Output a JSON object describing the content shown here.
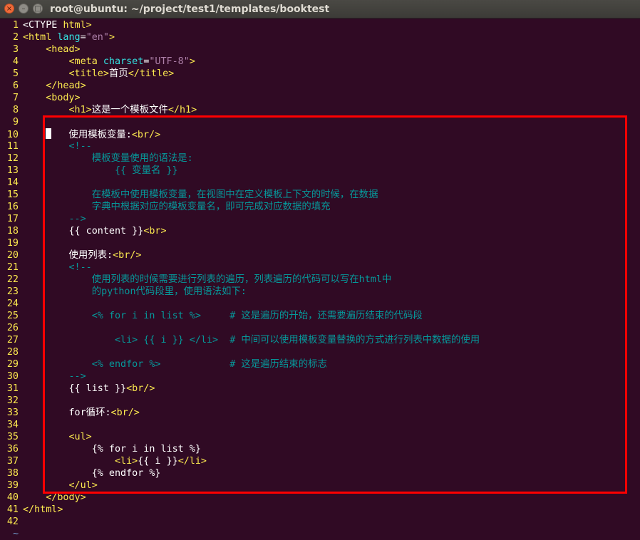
{
  "window": {
    "title": "root@ubuntu: ~/project/test1/templates/booktest",
    "buttons": {
      "close": "×",
      "minimize": "–",
      "maximize": "□"
    }
  },
  "editor": {
    "lines": [
      {
        "n": "1",
        "segs": [
          {
            "c": "txt",
            "t": "<CTYPE "
          },
          {
            "c": "tag",
            "t": "html>"
          }
        ]
      },
      {
        "n": "2",
        "segs": [
          {
            "c": "tag",
            "t": "<html "
          },
          {
            "c": "attr",
            "t": "lang"
          },
          {
            "c": "txt",
            "t": "="
          },
          {
            "c": "str",
            "t": "\"en\""
          },
          {
            "c": "tag",
            "t": ">"
          }
        ]
      },
      {
        "n": "3",
        "segs": [
          {
            "c": "txt",
            "t": "    "
          },
          {
            "c": "tag",
            "t": "<head>"
          }
        ]
      },
      {
        "n": "4",
        "segs": [
          {
            "c": "txt",
            "t": "        "
          },
          {
            "c": "tag",
            "t": "<meta "
          },
          {
            "c": "attr",
            "t": "charset"
          },
          {
            "c": "txt",
            "t": "="
          },
          {
            "c": "str",
            "t": "\"UTF-8\""
          },
          {
            "c": "tag",
            "t": ">"
          }
        ]
      },
      {
        "n": "5",
        "segs": [
          {
            "c": "txt",
            "t": "        "
          },
          {
            "c": "tag",
            "t": "<title>"
          },
          {
            "c": "txt",
            "t": "首页"
          },
          {
            "c": "tag",
            "t": "</title>"
          }
        ]
      },
      {
        "n": "6",
        "segs": [
          {
            "c": "txt",
            "t": "    "
          },
          {
            "c": "tag",
            "t": "</head>"
          }
        ]
      },
      {
        "n": "7",
        "segs": [
          {
            "c": "txt",
            "t": "    "
          },
          {
            "c": "tag",
            "t": "<body>"
          }
        ]
      },
      {
        "n": "8",
        "segs": [
          {
            "c": "txt",
            "t": "        "
          },
          {
            "c": "tag",
            "t": "<h1>"
          },
          {
            "c": "txt",
            "t": "这是一个模板文件"
          },
          {
            "c": "tag",
            "t": "</h1>"
          }
        ]
      },
      {
        "n": "9",
        "segs": []
      },
      {
        "n": "10",
        "segs": [
          {
            "c": "txt",
            "t": "    "
          },
          {
            "c": "cursor",
            "t": ""
          },
          {
            "c": "txt",
            "t": "   使用模板变量:"
          },
          {
            "c": "tag",
            "t": "<br/>"
          }
        ]
      },
      {
        "n": "11",
        "segs": [
          {
            "c": "cm",
            "t": "        <!--"
          }
        ]
      },
      {
        "n": "12",
        "segs": [
          {
            "c": "cm",
            "t": "            模板变量使用的语法是:"
          }
        ]
      },
      {
        "n": "13",
        "segs": [
          {
            "c": "cm",
            "t": "                {{ 变量名 }}"
          }
        ]
      },
      {
        "n": "14",
        "segs": []
      },
      {
        "n": "15",
        "segs": [
          {
            "c": "cm",
            "t": "            在模板中使用模板变量，在视图中在定义模板上下文的时候，在数据"
          }
        ]
      },
      {
        "n": "16",
        "segs": [
          {
            "c": "cm",
            "t": "            字典中根据对应的模板变量名，即可完成对应数据的填充"
          }
        ]
      },
      {
        "n": "17",
        "segs": [
          {
            "c": "cm",
            "t": "        -->"
          }
        ]
      },
      {
        "n": "18",
        "segs": [
          {
            "c": "txt",
            "t": "        {{ content }}"
          },
          {
            "c": "tag",
            "t": "<br>"
          }
        ]
      },
      {
        "n": "19",
        "segs": []
      },
      {
        "n": "20",
        "segs": [
          {
            "c": "txt",
            "t": "        使用列表:"
          },
          {
            "c": "tag",
            "t": "<br/>"
          }
        ]
      },
      {
        "n": "21",
        "segs": [
          {
            "c": "cm",
            "t": "        <!--"
          }
        ]
      },
      {
        "n": "22",
        "segs": [
          {
            "c": "cm",
            "t": "            使用列表的时候需要进行列表的遍历，列表遍历的代码可以写在html中"
          }
        ]
      },
      {
        "n": "23",
        "segs": [
          {
            "c": "cm",
            "t": "            的python代码段里，使用语法如下:"
          }
        ]
      },
      {
        "n": "24",
        "segs": []
      },
      {
        "n": "25",
        "segs": [
          {
            "c": "cm",
            "t": "            <% for i in list %>     # 这是遍历的开始，还需要遍历结束的代码段"
          }
        ]
      },
      {
        "n": "26",
        "segs": []
      },
      {
        "n": "27",
        "segs": [
          {
            "c": "cm",
            "t": "                <li> {{ i }} </li>  # 中间可以使用模板变量替换的方式进行列表中数据的使用"
          }
        ]
      },
      {
        "n": "28",
        "segs": []
      },
      {
        "n": "29",
        "segs": [
          {
            "c": "cm",
            "t": "            <% endfor %>            # 这是遍历结束的标志"
          }
        ]
      },
      {
        "n": "30",
        "segs": [
          {
            "c": "cm",
            "t": "        -->"
          }
        ]
      },
      {
        "n": "31",
        "segs": [
          {
            "c": "txt",
            "t": "        {{ list }}"
          },
          {
            "c": "tag",
            "t": "<br/>"
          }
        ]
      },
      {
        "n": "32",
        "segs": []
      },
      {
        "n": "33",
        "segs": [
          {
            "c": "txt",
            "t": "        for循环:"
          },
          {
            "c": "tag",
            "t": "<br/>"
          }
        ]
      },
      {
        "n": "34",
        "segs": []
      },
      {
        "n": "35",
        "segs": [
          {
            "c": "txt",
            "t": "        "
          },
          {
            "c": "tag",
            "t": "<ul>"
          }
        ]
      },
      {
        "n": "36",
        "segs": [
          {
            "c": "txt",
            "t": "            {% for i in list %}"
          }
        ]
      },
      {
        "n": "37",
        "segs": [
          {
            "c": "txt",
            "t": "                "
          },
          {
            "c": "tag",
            "t": "<li>"
          },
          {
            "c": "txt",
            "t": "{{ i }}"
          },
          {
            "c": "tag",
            "t": "</li>"
          }
        ]
      },
      {
        "n": "38",
        "segs": [
          {
            "c": "txt",
            "t": "            {% endfor %}"
          }
        ]
      },
      {
        "n": "39",
        "segs": [
          {
            "c": "txt",
            "t": "        "
          },
          {
            "c": "tag",
            "t": "</ul>"
          }
        ]
      },
      {
        "n": "40",
        "segs": [
          {
            "c": "txt",
            "t": "    "
          },
          {
            "c": "tag",
            "t": "</body>"
          }
        ]
      },
      {
        "n": "41",
        "segs": [
          {
            "c": "tag",
            "t": "</html>"
          }
        ]
      },
      {
        "n": "42",
        "segs": []
      },
      {
        "n": "~",
        "segs": []
      }
    ]
  },
  "colors": {
    "background": "#300a24",
    "line_numbers": "#fce94f",
    "tags": "#fce94f",
    "comments": "#06989a",
    "strings": "#ad7fa8",
    "highlight_box": "#ff0000"
  }
}
